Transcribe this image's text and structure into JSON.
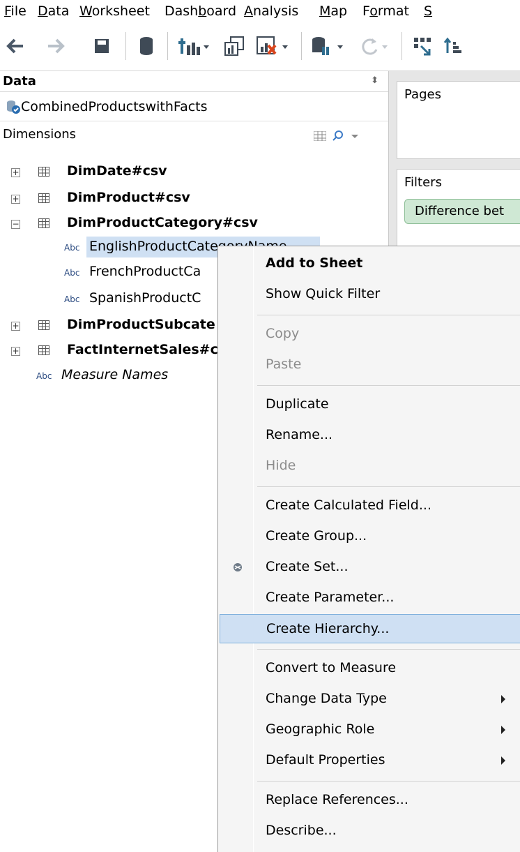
{
  "menubar": {
    "items": [
      {
        "label": "File",
        "ul": "F",
        "rest": "ile"
      },
      {
        "label": "Data",
        "ul": "D",
        "rest": "ata"
      },
      {
        "label": "Worksheet",
        "ul": "W",
        "rest": "orksheet"
      },
      {
        "label": "Dashboard",
        "pre": "Dash",
        "ul": "b",
        "rest": "oard"
      },
      {
        "label": "Analysis",
        "ul": "A",
        "rest": "nalysis"
      },
      {
        "label": "Map",
        "ul": "M",
        "rest": "ap"
      },
      {
        "label": "Format",
        "pre": "F",
        "ul": "o",
        "rest": "rmat"
      },
      {
        "label": "S",
        "ul": "S",
        "rest": ""
      }
    ]
  },
  "datapane": {
    "title": "Data",
    "datasource": "CombinedProductswithFacts",
    "dimensions_label": "Dimensions",
    "tables": [
      {
        "name": "DimDate#csv",
        "expanded": false
      },
      {
        "name": "DimProduct#csv",
        "expanded": false
      },
      {
        "name": "DimProductCategory#csv",
        "expanded": true
      }
    ],
    "fields": [
      {
        "type": "Abc",
        "name": "EnglishProductCategoryName",
        "visible": "EnglishProductCategoryName"
      },
      {
        "type": "Abc",
        "name": "FrenchProductCa",
        "visible": "FrenchProductCa"
      },
      {
        "type": "Abc",
        "name": "SpanishProductC",
        "visible": "SpanishProductC"
      }
    ],
    "tables_after": [
      {
        "name": "DimProductSubcate",
        "expanded": false
      },
      {
        "name": "FactInternetSales#c",
        "expanded": false
      }
    ],
    "measure_names": {
      "type": "Abc",
      "name": "Measure Names"
    }
  },
  "shelves": {
    "pages_title": "Pages",
    "filters_title": "Filters",
    "filter_pill": "Difference bet"
  },
  "context_menu": {
    "items": [
      {
        "label": "Add to Sheet",
        "bold": true
      },
      {
        "label": "Show Quick Filter"
      },
      {
        "sep": true
      },
      {
        "label": "Copy",
        "disabled": true
      },
      {
        "label": "Paste",
        "disabled": true
      },
      {
        "sep": true
      },
      {
        "label": "Duplicate"
      },
      {
        "label": "Rename..."
      },
      {
        "label": "Hide",
        "disabled": true
      },
      {
        "sep": true
      },
      {
        "label": "Create Calculated Field..."
      },
      {
        "label": "Create Group..."
      },
      {
        "label": "Create Set...",
        "icon": "set-icon"
      },
      {
        "label": "Create Parameter..."
      },
      {
        "label": "Create Hierarchy...",
        "hover": true
      },
      {
        "sep": true
      },
      {
        "label": "Convert to Measure"
      },
      {
        "label": "Change Data Type",
        "submenu": true
      },
      {
        "label": "Geographic Role",
        "submenu": true
      },
      {
        "label": "Default Properties",
        "submenu": true
      },
      {
        "sep": true
      },
      {
        "label": "Replace References..."
      },
      {
        "label": "Describe..."
      }
    ]
  },
  "colors": {
    "selection": "#cfe0f3",
    "filter_pill": "#cfe8d4",
    "menu_bg": "#f5f5f5",
    "disabled_text": "#8c8c8c"
  }
}
